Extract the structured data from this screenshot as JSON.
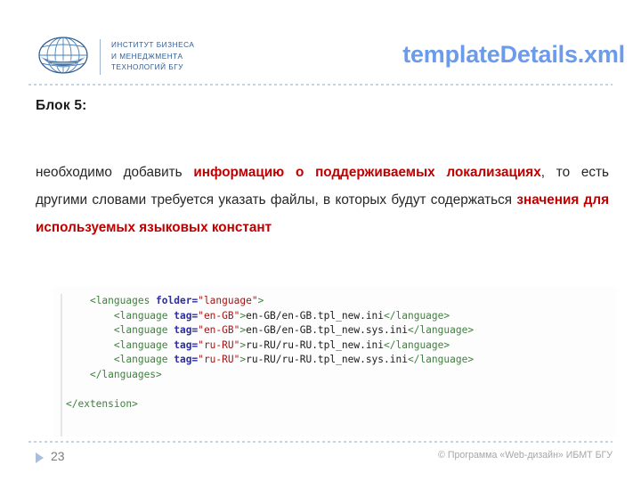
{
  "header": {
    "logo": {
      "icon": "globe-logo-icon",
      "line1": "ИНСТИТУТ БИЗНЕСА",
      "line2": "И МЕНЕДЖМЕНТА",
      "line3": "ТЕХНОЛОГИЙ БГУ"
    },
    "title": "templateDetails.xml",
    "title_color": "#6b9bea"
  },
  "content": {
    "block_label": "Блок 5:",
    "paragraph": {
      "part1": "необходимо добавить ",
      "highlight1": "информацию о поддерживаемых локализациях",
      "part2": ", то есть другими словами требуется указать файлы, в которых будут содержаться ",
      "highlight2": "значения для используемых языковых констант",
      "highlight_color": "#c00000"
    }
  },
  "code": {
    "language": "xml",
    "lines": [
      {
        "indent": "    ",
        "segments": [
          {
            "t": "<languages ",
            "c": "tag"
          },
          {
            "t": "folder=",
            "c": "attr"
          },
          {
            "t": "\"language\"",
            "c": "val"
          },
          {
            "t": ">",
            "c": "tag"
          }
        ]
      },
      {
        "indent": "        ",
        "segments": [
          {
            "t": "<language ",
            "c": "tag"
          },
          {
            "t": "tag=",
            "c": "attr"
          },
          {
            "t": "\"en-GB\"",
            "c": "val"
          },
          {
            "t": ">",
            "c": "tag"
          },
          {
            "t": "en-GB/en-GB.tpl_new.ini",
            "c": "text"
          },
          {
            "t": "</language>",
            "c": "tag"
          }
        ]
      },
      {
        "indent": "        ",
        "segments": [
          {
            "t": "<language ",
            "c": "tag"
          },
          {
            "t": "tag=",
            "c": "attr"
          },
          {
            "t": "\"en-GB\"",
            "c": "val"
          },
          {
            "t": ">",
            "c": "tag"
          },
          {
            "t": "en-GB/en-GB.tpl_new.sys.ini",
            "c": "text"
          },
          {
            "t": "</language>",
            "c": "tag"
          }
        ]
      },
      {
        "indent": "        ",
        "segments": [
          {
            "t": "<language ",
            "c": "tag"
          },
          {
            "t": "tag=",
            "c": "attr"
          },
          {
            "t": "\"ru-RU\"",
            "c": "val"
          },
          {
            "t": ">",
            "c": "tag"
          },
          {
            "t": "ru-RU/ru-RU.tpl_new.ini",
            "c": "text"
          },
          {
            "t": "</language>",
            "c": "tag"
          }
        ]
      },
      {
        "indent": "        ",
        "segments": [
          {
            "t": "<language ",
            "c": "tag"
          },
          {
            "t": "tag=",
            "c": "attr"
          },
          {
            "t": "\"ru-RU\"",
            "c": "val"
          },
          {
            "t": ">",
            "c": "tag"
          },
          {
            "t": "ru-RU/ru-RU.tpl_new.sys.ini",
            "c": "text"
          },
          {
            "t": "</language>",
            "c": "tag"
          }
        ]
      },
      {
        "indent": "    ",
        "segments": [
          {
            "t": "</languages>",
            "c": "tag"
          }
        ]
      },
      {
        "indent": "",
        "segments": []
      },
      {
        "indent": "",
        "segments": [
          {
            "t": "</extension>",
            "c": "tag"
          }
        ]
      }
    ]
  },
  "footer": {
    "slide_number": "23",
    "credit": "© Программа «Web-дизайн» ИБМТ БГУ",
    "marker_icon": "triangle-right-icon"
  }
}
